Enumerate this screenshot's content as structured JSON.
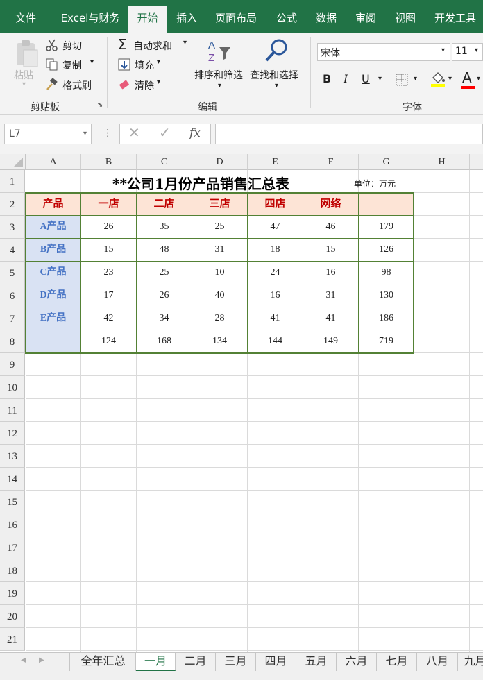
{
  "menu": {
    "tabs": [
      {
        "label": "文件",
        "active": false
      },
      {
        "label": "Excel与财务",
        "active": false
      },
      {
        "label": "开始",
        "active": true
      },
      {
        "label": "插入",
        "active": false
      },
      {
        "label": "页面布局",
        "active": false
      },
      {
        "label": "公式",
        "active": false
      },
      {
        "label": "数据",
        "active": false
      },
      {
        "label": "审阅",
        "active": false
      },
      {
        "label": "视图",
        "active": false
      },
      {
        "label": "开发工具",
        "active": false
      }
    ]
  },
  "ribbon": {
    "clipboard": {
      "group": "剪贴板",
      "paste": "粘贴",
      "cut": "剪切",
      "copy": "复制",
      "format_painter": "格式刷"
    },
    "editing": {
      "group": "编辑",
      "autosum": "自动求和",
      "fill": "填充",
      "clear": "清除",
      "sort_filter": "排序和筛选",
      "find_select": "查找和选择"
    },
    "font": {
      "group": "字体",
      "name": "宋体",
      "size": "11",
      "bold": "B",
      "italic": "I",
      "underline": "U",
      "font_color_icon": "A",
      "fill_color": "#ffff00",
      "font_color": "#ff0000"
    }
  },
  "formula_bar": {
    "name_box": "L7",
    "fx_label": "fx",
    "formula": ""
  },
  "sheet": {
    "columns": [
      "A",
      "B",
      "C",
      "D",
      "E",
      "F",
      "G",
      "H"
    ],
    "rows": [
      "1",
      "2",
      "3",
      "4",
      "5",
      "6",
      "7",
      "8",
      "9",
      "10",
      "11",
      "12",
      "13",
      "14",
      "15",
      "16",
      "17",
      "18",
      "19",
      "20",
      "21"
    ],
    "title": "**公司1月份产品销售汇总表",
    "unit": "单位：万元",
    "headers": [
      "产品",
      "一店",
      "二店",
      "三店",
      "四店",
      "网络",
      ""
    ],
    "data": [
      [
        "A产品",
        "26",
        "35",
        "25",
        "47",
        "46",
        "179"
      ],
      [
        "B产品",
        "15",
        "48",
        "31",
        "18",
        "15",
        "126"
      ],
      [
        "C产品",
        "23",
        "25",
        "10",
        "24",
        "16",
        "98"
      ],
      [
        "D产品",
        "17",
        "26",
        "40",
        "16",
        "31",
        "130"
      ],
      [
        "E产品",
        "42",
        "34",
        "28",
        "41",
        "41",
        "186"
      ],
      [
        "",
        "124",
        "168",
        "134",
        "144",
        "149",
        "719"
      ]
    ]
  },
  "sheet_tabs": [
    {
      "label": "全年汇总",
      "active": false
    },
    {
      "label": "一月",
      "active": true
    },
    {
      "label": "二月",
      "active": false
    },
    {
      "label": "三月",
      "active": false
    },
    {
      "label": "四月",
      "active": false
    },
    {
      "label": "五月",
      "active": false
    },
    {
      "label": "六月",
      "active": false
    },
    {
      "label": "七月",
      "active": false
    },
    {
      "label": "八月",
      "active": false
    },
    {
      "label": "九月",
      "active": false
    }
  ],
  "colors": {
    "accent": "#217346",
    "header_fill": "#fde4d6",
    "header_text": "#c00000",
    "product_fill": "#d9e2f3",
    "product_text": "#4472c4",
    "table_border": "#538135"
  }
}
